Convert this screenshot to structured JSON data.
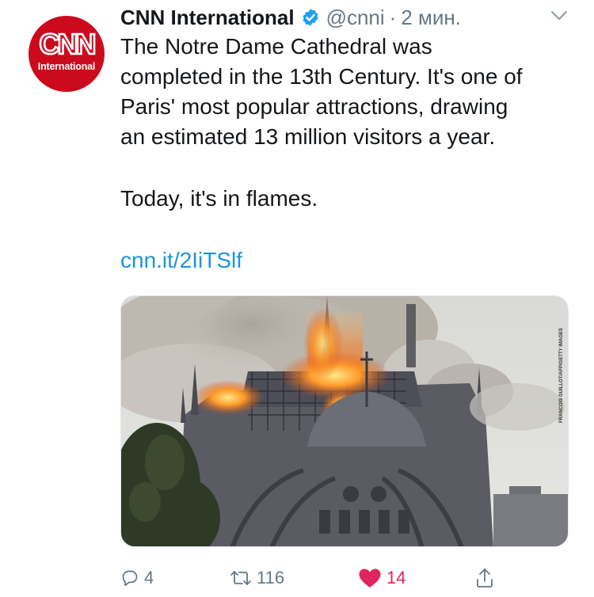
{
  "tweet": {
    "author": {
      "display_name": "CNN International",
      "handle": "@cnni",
      "verified": true,
      "avatar_logo": "CNN",
      "avatar_sub": "International"
    },
    "separator": "·",
    "time": "2 мин.",
    "text_lines": [
      "The Notre Dame Cathedral was",
      "completed in the 13th Century. It's one of",
      "Paris' most popular attractions, drawing",
      "an estimated 13 million visitors a year."
    ],
    "text_para2": "Today, it's in flames.",
    "link": "cnn.it/2IiTSlf",
    "media": {
      "type": "photo",
      "subject": "Notre Dame cathedral on fire",
      "photo_credit": "FRANCOIS GUILLOT/AFP/GETTY IMAGES"
    },
    "actions": {
      "reply_count": "4",
      "retweet_count": "116",
      "like_count": "14",
      "liked": true
    }
  },
  "colors": {
    "text": "#14171a",
    "secondary": "#657786",
    "link": "#1b95e0",
    "like": "#e0245e",
    "verified": "#1da1f2",
    "cnn_red": "#cc0a1e"
  },
  "icons": [
    "cnn-avatar-logo",
    "verified-badge-icon",
    "chevron-down-icon",
    "reply-icon",
    "retweet-icon",
    "heart-icon",
    "share-icon"
  ]
}
